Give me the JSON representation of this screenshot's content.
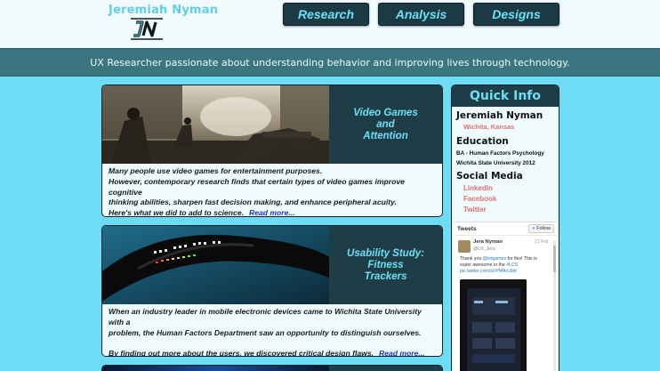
{
  "header": {
    "brand_name": "Jeremiah Nyman",
    "nav": [
      "Research",
      "Analysis",
      "Designs"
    ]
  },
  "tagline": "UX Researcher passionate about understanding behavior and improving lives through technology.",
  "cards": [
    {
      "title": "Video Games\nand\nAttention",
      "body_lines": [
        "Many people use video games for entertainment purposes.",
        "However, contemporary research finds that certain types of video games improve cognitive",
        "thinking abilities, sharpen fast decision making, and enhance peripheral acuity."
      ],
      "last_line": "Here's what we did to add to science.",
      "read_more": "Read more..."
    },
    {
      "title": "Usability Study:\nFitness\nTrackers",
      "body_lines": [
        "When an industry leader in mobile electronic devices came to Wichita State University with a",
        "problem, the Human Factors Department saw an opportunity to distinguish ourselves."
      ],
      "last_line": "By finding out more about the users, we discovered critical design flaws.",
      "read_more": "Read more..."
    }
  ],
  "quick_info": {
    "title": "Quick Info",
    "name": "Jeremiah Nyman",
    "location": "Wichita, Kansas",
    "education_heading": "Education",
    "degree": "BA - Human Factors Psychology",
    "school": "Wichita State University 2012",
    "social_heading": "Social Media",
    "links": [
      "LinkedIn",
      "Facebook",
      "Twitter"
    ]
  },
  "tweets": {
    "title": "Tweets",
    "follow": "Follow",
    "author": "Jera Nyman",
    "handle": "@UX_Jera",
    "date": "21 Feb",
    "text_1": "Thank you",
    "mention": "@iotgames",
    "text_2": "for this! This is super awesome in the",
    "hashtag": "#LCS",
    "pic_link": "pic.twitter.com/aFPMAcv9di"
  },
  "colors": {
    "page_bg": "#6fdcf6",
    "accent": "#6ae0f8",
    "dark_teal": "#1e3d46",
    "link_red": "#e0706e",
    "read_more_blue": "#1a36c4"
  }
}
